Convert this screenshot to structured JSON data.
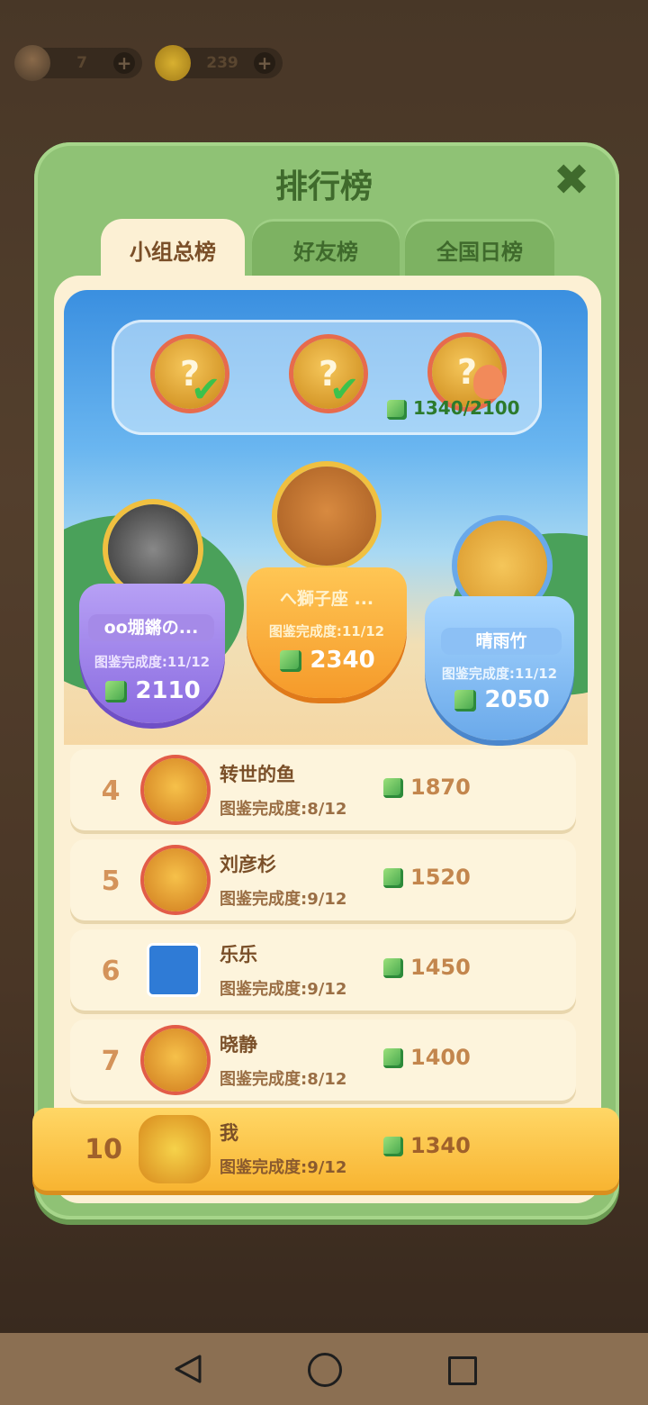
{
  "status": {
    "energy": "7",
    "coins": "239",
    "plus": "+"
  },
  "panel": {
    "title": "排行榜",
    "close": "✖"
  },
  "tabs": [
    {
      "label": "小组总榜",
      "active": true
    },
    {
      "label": "好友榜",
      "active": false
    },
    {
      "label": "全国日榜",
      "active": false
    }
  ],
  "progress": {
    "current": 1340,
    "total": 2100,
    "text": "1340/2100",
    "stages": [
      {
        "mark": "?",
        "completed": true
      },
      {
        "mark": "?",
        "completed": true
      },
      {
        "mark": "?",
        "completed": false
      }
    ]
  },
  "podium": {
    "first": {
      "name": "へ獅子座 ...",
      "progress_label": "图鉴完成度:11/12",
      "score": "2340"
    },
    "second": {
      "name": "oo堋�span class=\"d\"></span>の...",
      "progress_label": "图鉴完成度:11/12",
      "score": "2110"
    },
    "third": {
      "name": "晴雨竹",
      "progress_label": "图鉴完成度:11/12",
      "score": "2050"
    }
  },
  "rows": [
    {
      "rank": "4",
      "name": "转世的鱼",
      "progress_label": "图鉴完成度:8/12",
      "score": "1870"
    },
    {
      "rank": "5",
      "name": "刘彦杉",
      "progress_label": "图鉴完成度:9/12",
      "score": "1520"
    },
    {
      "rank": "6",
      "name": "乐乐",
      "progress_label": "图鉴完成度:9/12",
      "score": "1450"
    },
    {
      "rank": "7",
      "name": "晓静",
      "progress_label": "图鉴完成度:8/12",
      "score": "1400"
    }
  ],
  "me": {
    "rank": "10",
    "name": "我",
    "progress_label": "图鉴完成度:9/12",
    "score": "1340"
  },
  "colors": {
    "panel_green": "#8fc275",
    "gold": "#f8b431",
    "purple": "#8a6be0",
    "blue": "#6aa9ea"
  }
}
